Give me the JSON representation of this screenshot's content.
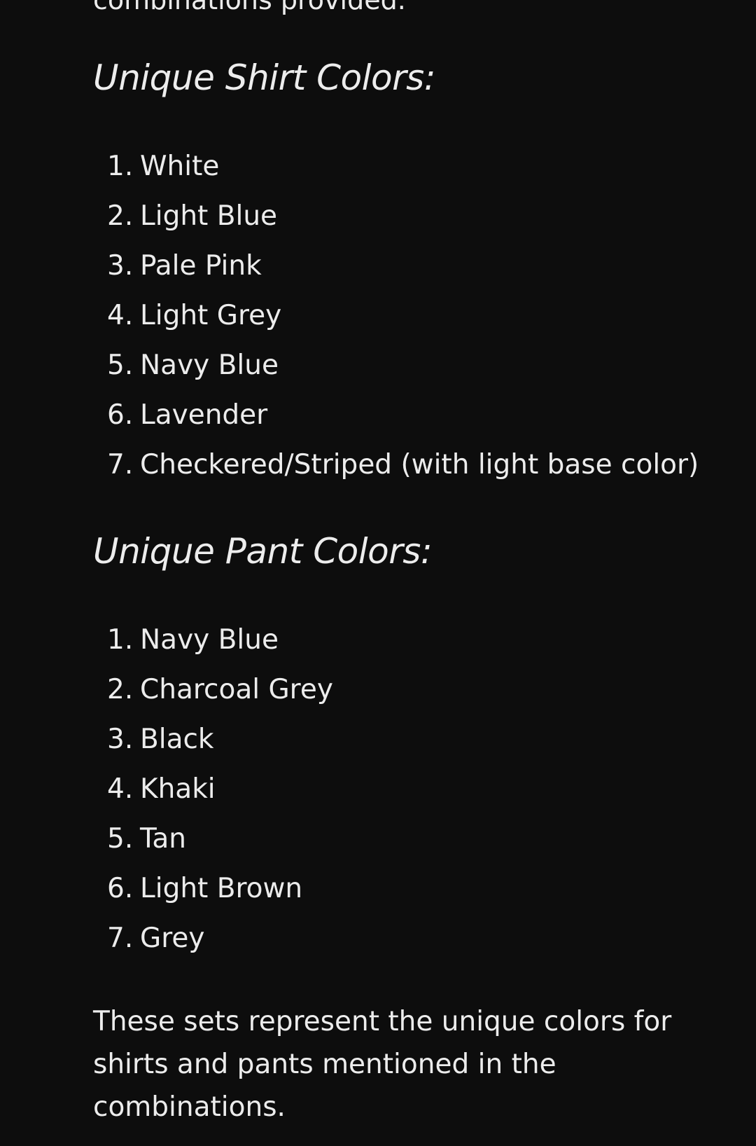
{
  "intro_line": "combinations provided.",
  "shirts": {
    "heading": "Unique Shirt Colors:",
    "items": [
      {
        "num": "1.",
        "label": "White"
      },
      {
        "num": "2.",
        "label": "Light Blue"
      },
      {
        "num": "3.",
        "label": "Pale Pink"
      },
      {
        "num": "4.",
        "label": "Light Grey"
      },
      {
        "num": "5.",
        "label": "Navy Blue"
      },
      {
        "num": "6.",
        "label": "Lavender"
      },
      {
        "num": "7.",
        "label": "Checkered/Striped (with light base color)"
      }
    ]
  },
  "pants": {
    "heading": "Unique Pant Colors:",
    "items": [
      {
        "num": "1.",
        "label": "Navy Blue"
      },
      {
        "num": "2.",
        "label": "Charcoal Grey"
      },
      {
        "num": "3.",
        "label": "Black"
      },
      {
        "num": "4.",
        "label": "Khaki"
      },
      {
        "num": "5.",
        "label": "Tan"
      },
      {
        "num": "6.",
        "label": "Light Brown"
      },
      {
        "num": "7.",
        "label": "Grey"
      }
    ]
  },
  "summary": "These sets represent the unique colors for shirts and pants mentioned in the combinations."
}
